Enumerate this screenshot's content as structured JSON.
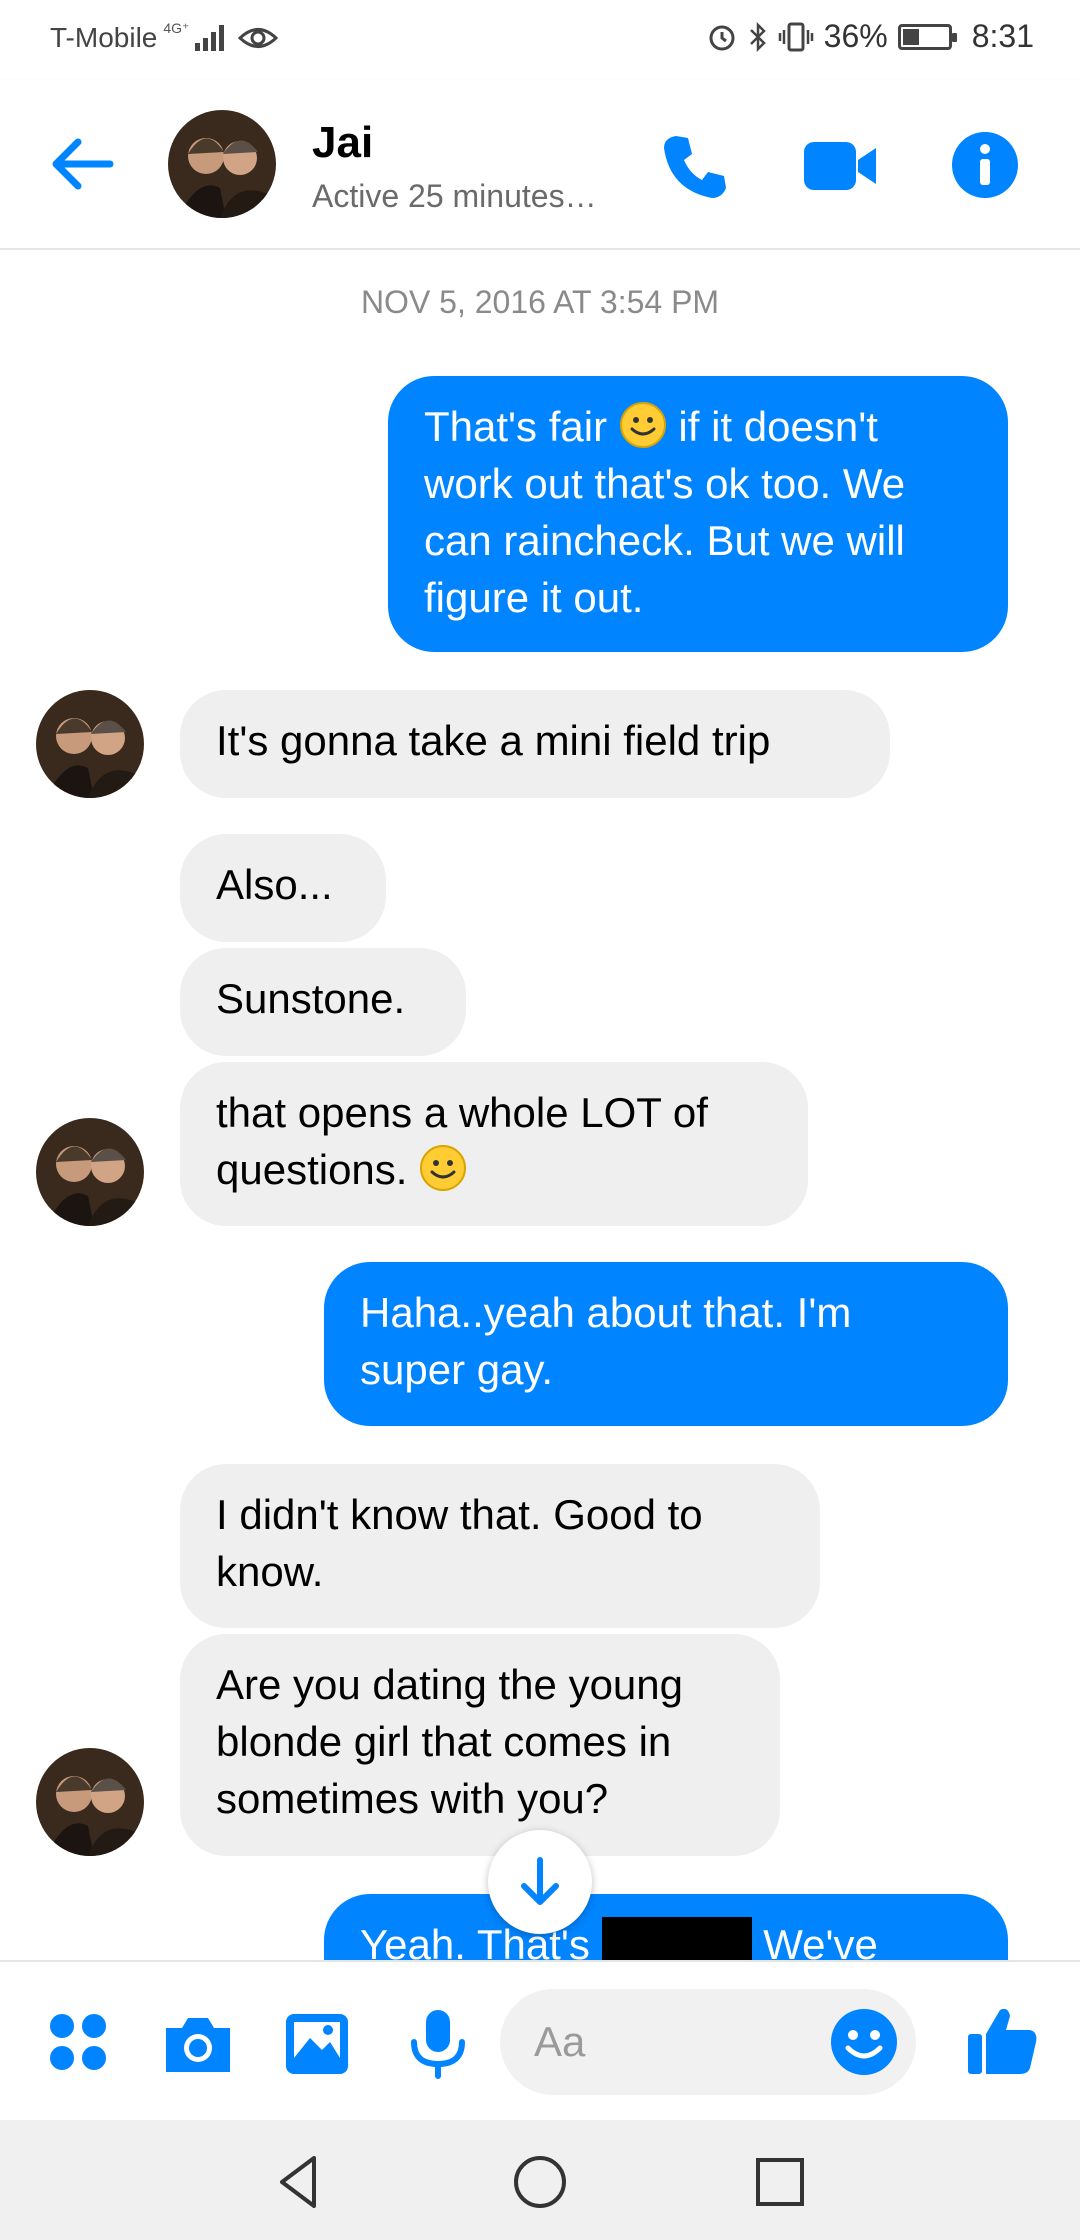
{
  "status_bar": {
    "carrier": "T-Mobile",
    "network_type": "4G⁺",
    "battery_percent": "36%",
    "battery_level": 0.36,
    "time": "8:31"
  },
  "header": {
    "contact_name": "Jai",
    "contact_status": "Active 25 minutes…"
  },
  "conversation": {
    "timestamp": "NOV 5, 2016 AT 3:54 PM",
    "messages": [
      {
        "from": "me",
        "text_parts": [
          "That's fair ",
          " if it doesn't\nwork out that's ok too. We\ncan raincheck. But we will\nfigure it out."
        ]
      },
      {
        "from": "contact",
        "text": "It's gonna take a mini field trip"
      },
      {
        "from": "contact",
        "text": "Also..."
      },
      {
        "from": "contact",
        "text": "Sunstone."
      },
      {
        "from": "contact",
        "text": "that opens a whole LOT of\nquestions.  "
      },
      {
        "from": "me",
        "text": "Haha..yeah about that. I'm\nsuper gay."
      },
      {
        "from": "contact",
        "text": "I didn't know that.  Good to\nknow."
      },
      {
        "from": "contact",
        "text": "Are you dating the young\nblonde girl that comes in\nsometimes with you?"
      },
      {
        "from": "me",
        "text_parts": [
          "Yeah. That's ",
          " We've"
        ]
      }
    ]
  },
  "composer": {
    "placeholder": "Aa"
  },
  "colors": {
    "accent": "#0084ff",
    "incoming_bubble": "#efefef",
    "outgoing_text": "#ffffff"
  }
}
